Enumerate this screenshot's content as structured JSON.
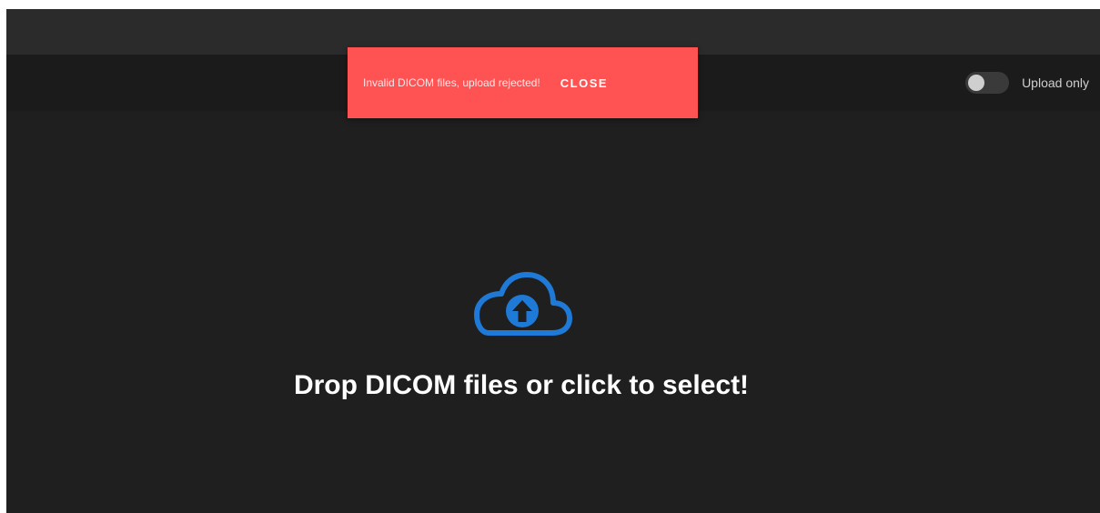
{
  "notification": {
    "message": "Invalid DICOM files, upload rejected!",
    "close_label": "CLOSE"
  },
  "toolbar": {
    "upload_only_label": "Upload only",
    "upload_only_enabled": false
  },
  "dropzone": {
    "prompt": "Drop DICOM files or click to select!",
    "icon": "cloud-upload-icon"
  },
  "colors": {
    "background": "#1f1f1f",
    "top_bar": "#2b2b2b",
    "notification": "#ff5252",
    "icon_accent": "#1e7ad6"
  }
}
